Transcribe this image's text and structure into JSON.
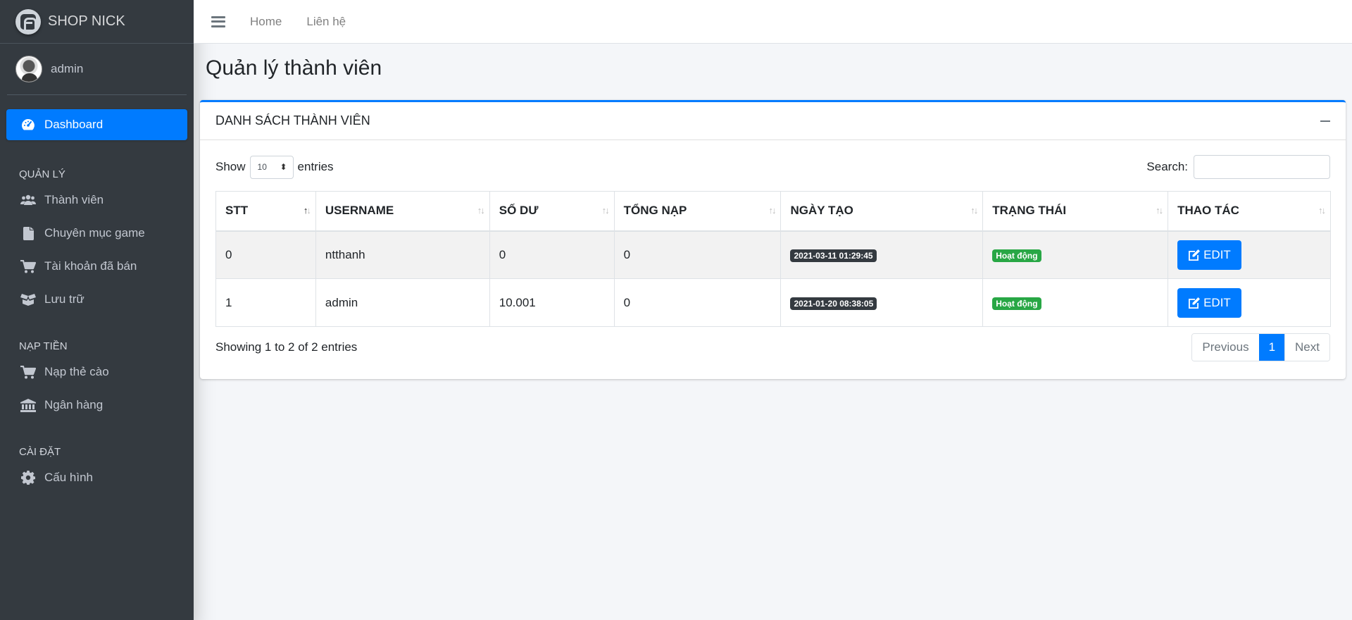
{
  "brand": {
    "name": "SHOP NICK"
  },
  "user": {
    "name": "admin"
  },
  "sidebar": {
    "dashboard": {
      "label": "Dashboard",
      "icon": "tachometer-icon"
    },
    "sections": [
      {
        "header": "QUẢN LÝ",
        "items": [
          {
            "label": "Thành viên",
            "icon": "users-icon"
          },
          {
            "label": "Chuyên mục game",
            "icon": "file-icon"
          },
          {
            "label": "Tài khoản đã bán",
            "icon": "cart-icon"
          },
          {
            "label": "Lưu trữ",
            "icon": "box-icon"
          }
        ]
      },
      {
        "header": "NẠP TIỀN",
        "items": [
          {
            "label": "Nạp thẻ cào",
            "icon": "cart-icon"
          },
          {
            "label": "Ngân hàng",
            "icon": "bank-icon"
          }
        ]
      },
      {
        "header": "CÀI ĐẶT",
        "items": [
          {
            "label": "Cấu hình",
            "icon": "gear-icon"
          }
        ]
      }
    ]
  },
  "topbar": {
    "home": "Home",
    "contact": "Liên hệ"
  },
  "page": {
    "title": "Quản lý thành viên"
  },
  "card": {
    "title": "DANH SÁCH THÀNH VIÊN",
    "show_label": "Show",
    "show_value": "10",
    "entries_label": "entries",
    "search_label": "Search:",
    "search_value": ""
  },
  "table": {
    "columns": [
      "STT",
      "USERNAME",
      "SỐ DƯ",
      "TỔNG NẠP",
      "NGÀY TẠO",
      "TRẠNG THÁI",
      "THAO TÁC"
    ],
    "rows": [
      {
        "stt": "0",
        "username": "ntthanh",
        "balance": "0",
        "total": "0",
        "created": "2021-03-11 01:29:45",
        "status": "Hoạt động",
        "action": "EDIT"
      },
      {
        "stt": "1",
        "username": "admin",
        "balance": "10.001",
        "total": "0",
        "created": "2021-01-20 08:38:05",
        "status": "Hoạt động",
        "action": "EDIT"
      }
    ]
  },
  "footer": {
    "info": "Showing 1 to 2 of 2 entries",
    "previous": "Previous",
    "page": "1",
    "next": "Next"
  },
  "colors": {
    "primary": "#007bff",
    "sidebar": "#343a40",
    "success": "#28a745"
  }
}
